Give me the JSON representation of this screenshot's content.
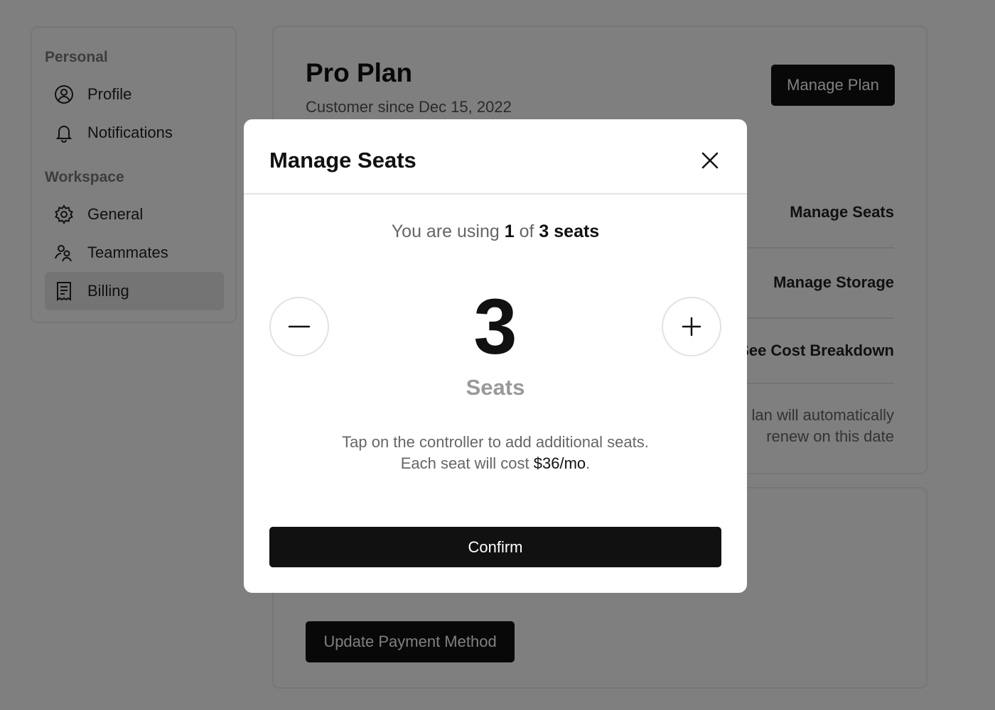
{
  "sidebar": {
    "personal_label": "Personal",
    "workspace_label": "Workspace",
    "items": [
      {
        "label": "Profile",
        "icon": "profile-icon"
      },
      {
        "label": "Notifications",
        "icon": "bell-icon"
      },
      {
        "label": "General",
        "icon": "gear-icon"
      },
      {
        "label": "Teammates",
        "icon": "users-icon"
      },
      {
        "label": "Billing",
        "icon": "receipt-icon",
        "active": true
      }
    ]
  },
  "plan": {
    "title": "Pro Plan",
    "subtitle": "Customer since Dec 15, 2022",
    "manage_plan_label": "Manage Plan",
    "links": [
      "Manage Seats",
      "Manage Storage",
      "See Cost Breakdown"
    ],
    "renew_line1": "lan will automatically",
    "renew_line2": "renew on this date"
  },
  "payment": {
    "update_label": "Update Payment Method"
  },
  "modal": {
    "title": "Manage Seats",
    "usage_prefix": "You are using",
    "used": "1",
    "of": "of",
    "total": "3 seats",
    "seat_count": "3",
    "seat_unit": "Seats",
    "help_line1": "Tap on the controller to add additional seats.",
    "help_line2_prefix": "Each seat will cost",
    "price": "$36/mo",
    "help_line2_suffix": ".",
    "confirm_label": "Confirm"
  },
  "colors": {
    "overlay": "rgba(0,0,0,0.5)",
    "primary": "#111111",
    "muted": "#999999"
  }
}
